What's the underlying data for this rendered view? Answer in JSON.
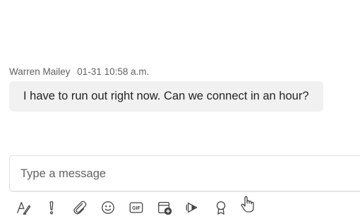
{
  "message": {
    "sender": "Warren Mailey",
    "timestamp": "01-31 10:58 a.m.",
    "text": "I have to run out right now. Can we connect in an hour?"
  },
  "compose": {
    "placeholder": "Type a message"
  },
  "toolbar": {
    "gif_label": "GIF",
    "icons": [
      "format-icon",
      "important-icon",
      "attach-icon",
      "emoji-icon",
      "gif-icon",
      "schedule-meeting-icon",
      "stream-icon",
      "praise-icon"
    ]
  },
  "colors": {
    "bubble_bg": "#f1f1f1",
    "text": "#242424",
    "meta_text": "#616161",
    "icon": "#424242"
  }
}
